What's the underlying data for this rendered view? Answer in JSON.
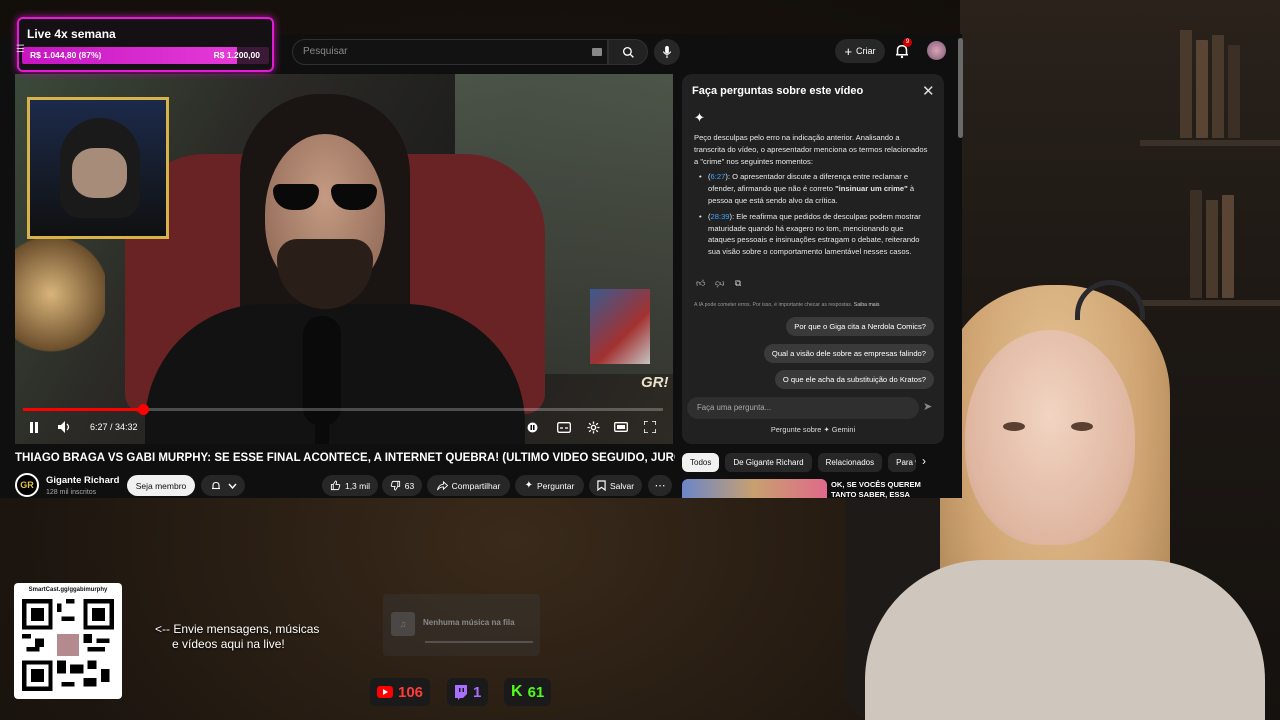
{
  "goal": {
    "title": "Live 4x semana",
    "current": "R$ 1.044,80 (87%)",
    "target": "R$ 1.200,00",
    "progress": 0.87
  },
  "topbar": {
    "search_placeholder": "Pesquisar",
    "create_label": "Criar",
    "notification_count": "9"
  },
  "player": {
    "time": "6:27 / 34:32",
    "progress": 0.1875,
    "watermark": "GR!"
  },
  "video": {
    "title": "THIAGO BRAGA VS GABI MURPHY: SE ESSE FINAL ACONTECE, A INTERNET QUEBRA! (ÚLTIMO VÍDEO SEGUIDO, JURO)",
    "channel_initials": "GR",
    "channel_name": "Gigante Richard",
    "subscribers": "128 mil inscritos",
    "member_label": "Seja membro",
    "likes": "1,3 mil",
    "dislikes": "63",
    "share_label": "Compartilhar",
    "ask_label": "Perguntar",
    "save_label": "Salvar"
  },
  "ai_panel": {
    "title": "Faça perguntas sobre este vídeo",
    "intro": "Peço desculpas pelo erro na indicação anterior. Analisando a transcrita do vídeo, o apresentador menciona os termos relacionados a \"crime\" nos seguintes momentos:",
    "items": [
      {
        "ts": "6:27",
        "pre": ": O apresentador discute a diferença entre reclamar e ofender, afirmando que não é correto ",
        "bold": "\"insinuar um crime\"",
        "post": " à pessoa que está sendo alvo da crítica."
      },
      {
        "ts": "28:39",
        "pre": ": Ele reafirma que pedidos de desculpas podem mostrar maturidade quando há exagero no tom, mencionando que ataques pessoais e insinuações estragam o debate, reiterando sua visão sobre o comportamento lamentável nesses casos.",
        "bold": "",
        "post": ""
      }
    ],
    "disclaimer": "A IA pode cometer erros. Por isso, é importante checar as respostas.",
    "learn_more": "Saiba mais",
    "suggestions": [
      "Por que o Giga cita a Nerdola Comics?",
      "Qual a visão dele sobre as empresas falindo?",
      "O que ele acha da substituição do Kratos?"
    ],
    "input_placeholder": "Faça uma pergunta...",
    "footer": "Pergunte sobre ✦ Gemini"
  },
  "chips": [
    "Todos",
    "De Gigante Richard",
    "Relacionados",
    "Para v"
  ],
  "recommendation": {
    "title": "OK, SE VOCÊS QUEREM TANTO SABER, ESSA"
  },
  "overlay": {
    "qr_label": "SmartCast.gg/ggabimurphy",
    "send_message": "<-- Envie mensagens, músicas",
    "send_message_2": "e vídeos aqui na live!",
    "music_empty": "Nenhuma música na fila",
    "youtube_viewers": "106",
    "twitch_viewers": "1",
    "kick_viewers": "61"
  },
  "colors": {
    "goal_accent": "#e21bd6",
    "youtube_red": "#ff0000",
    "twitch": "#a970ff",
    "kick": "#53fc18",
    "link": "#3ea6ff"
  }
}
